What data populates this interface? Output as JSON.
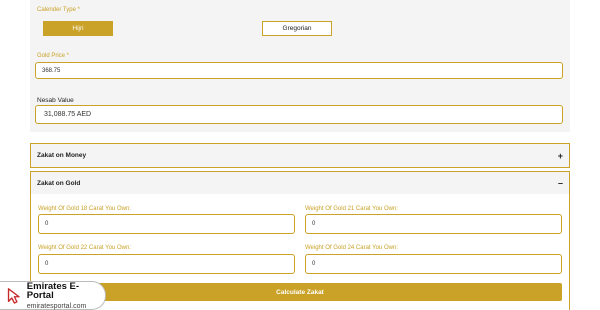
{
  "calendar": {
    "label": "Calender Type *",
    "options": [
      "Hijri",
      "Gregorian"
    ],
    "selected": "Hijri"
  },
  "gold_price": {
    "label": "Gold Price *",
    "value": "368.75"
  },
  "nesab": {
    "label": "Nesab Value",
    "value": "31,088.75 AED"
  },
  "accordions": [
    {
      "title": "Zakat on Money",
      "toggle": "+"
    },
    {
      "title": "Zakat on Gold",
      "toggle": "–"
    }
  ],
  "gold_fields": [
    {
      "label": "Weight Of Gold 18 Carat You Own:",
      "value": "0"
    },
    {
      "label": "Weight Of Gold 21 Carat You Own:",
      "value": "0"
    },
    {
      "label": "Weight Of Gold 22 Carat You Own:",
      "value": "0"
    },
    {
      "label": "Weight Of Gold 24 Carat You Own:",
      "value": "0"
    }
  ],
  "calculate_label": "Calculate Zakat",
  "watermark": {
    "name": "Emirates E-Portal",
    "site": "emiratesportal.com"
  },
  "colors": {
    "accent": "#c9a227",
    "panel": "#f4f4f4"
  }
}
